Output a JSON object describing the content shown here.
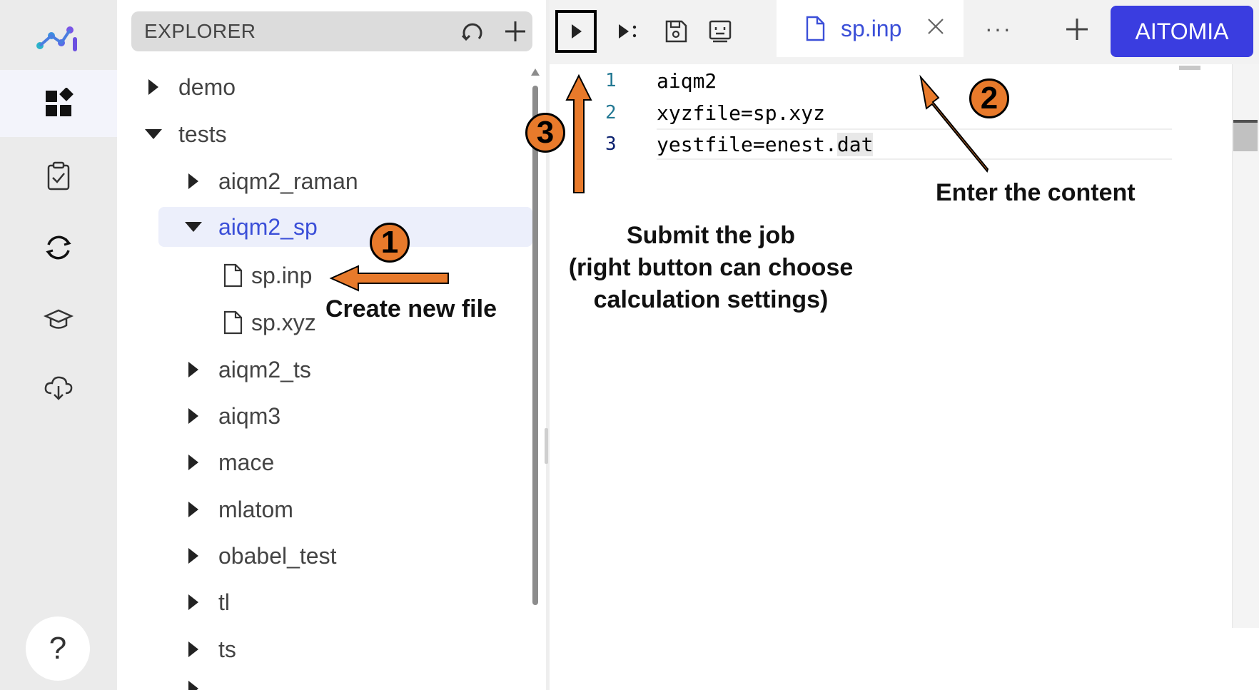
{
  "explorer": {
    "title": "EXPLORER",
    "tree": [
      {
        "label": "demo",
        "expanded": false
      },
      {
        "label": "tests",
        "expanded": true
      },
      {
        "label": "aiqm2_raman",
        "expanded": false
      },
      {
        "label": "aiqm2_sp",
        "expanded": true,
        "selected": true
      },
      {
        "label": "sp.inp",
        "type": "file"
      },
      {
        "label": "sp.xyz",
        "type": "file"
      },
      {
        "label": "aiqm2_ts",
        "expanded": false
      },
      {
        "label": "aiqm3",
        "expanded": false
      },
      {
        "label": "mace",
        "expanded": false
      },
      {
        "label": "mlatom",
        "expanded": false
      },
      {
        "label": "obabel_test",
        "expanded": false
      },
      {
        "label": "tl",
        "expanded": false
      },
      {
        "label": "ts",
        "expanded": false
      }
    ]
  },
  "activity_bar": {
    "icons": [
      "logo-icon",
      "extensions-icon",
      "clipboard-check-icon",
      "sync-icon",
      "graduation-cap-icon",
      "cloud-download-icon"
    ],
    "help_label": "?"
  },
  "toolbar": {
    "more_label": "···",
    "brand_label": "AITOMIA"
  },
  "tab": {
    "label": "sp.inp"
  },
  "editor": {
    "lines": [
      {
        "number": "1",
        "text": "aiqm2"
      },
      {
        "number": "2",
        "text": "xyzfile=sp.xyz"
      },
      {
        "number": "3",
        "text_before": "yestfile=enest.",
        "text_highlight": "dat"
      }
    ]
  },
  "annotations": {
    "badge1": "1",
    "badge2": "2",
    "badge3": "3",
    "create_file": "Create new file",
    "enter_content": "Enter the content",
    "submit_line1": "Submit the job",
    "submit_line2": "(right button can choose",
    "submit_line3": "calculation settings)"
  },
  "colors": {
    "accent": "#3b4fd8",
    "brand": "#3a3de0",
    "annotation_orange": "#e87a2b"
  }
}
